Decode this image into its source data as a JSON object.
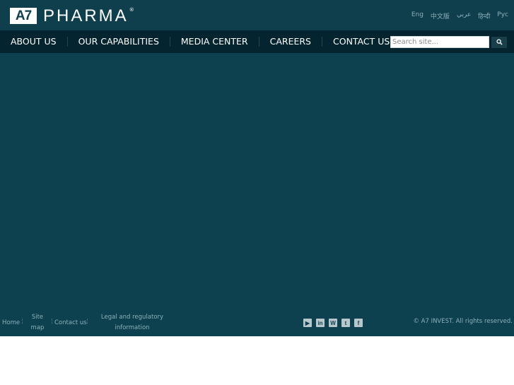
{
  "header": {
    "logo_box": "A7",
    "logo_text": "PHARMA",
    "logo_mark": "®",
    "languages": [
      "Eng",
      "中文版",
      "عربي",
      "हिन्दी",
      "Рус"
    ]
  },
  "nav": {
    "items": [
      "ABOUT US",
      "OUR CAPABILITIES",
      "MEDIA CENTER",
      "CAREERS",
      "CONTACT US"
    ],
    "search_placeholder": "Search site...",
    "search_icon": "search-icon"
  },
  "footer": {
    "home": "Home",
    "sitemap": "Site map",
    "contact": "Contact us",
    "legal": "Legal and regulatory information",
    "social_icons": [
      "youtube-icon",
      "linkedin-icon",
      "wordpress-icon",
      "twitter-icon",
      "facebook-icon"
    ],
    "copyright": "© A7 INVEST. All rights reserved."
  },
  "colors": {
    "page_bg": "#0d4150",
    "header_bg": "#0f3f4d",
    "nav_bg": "#04252f"
  }
}
